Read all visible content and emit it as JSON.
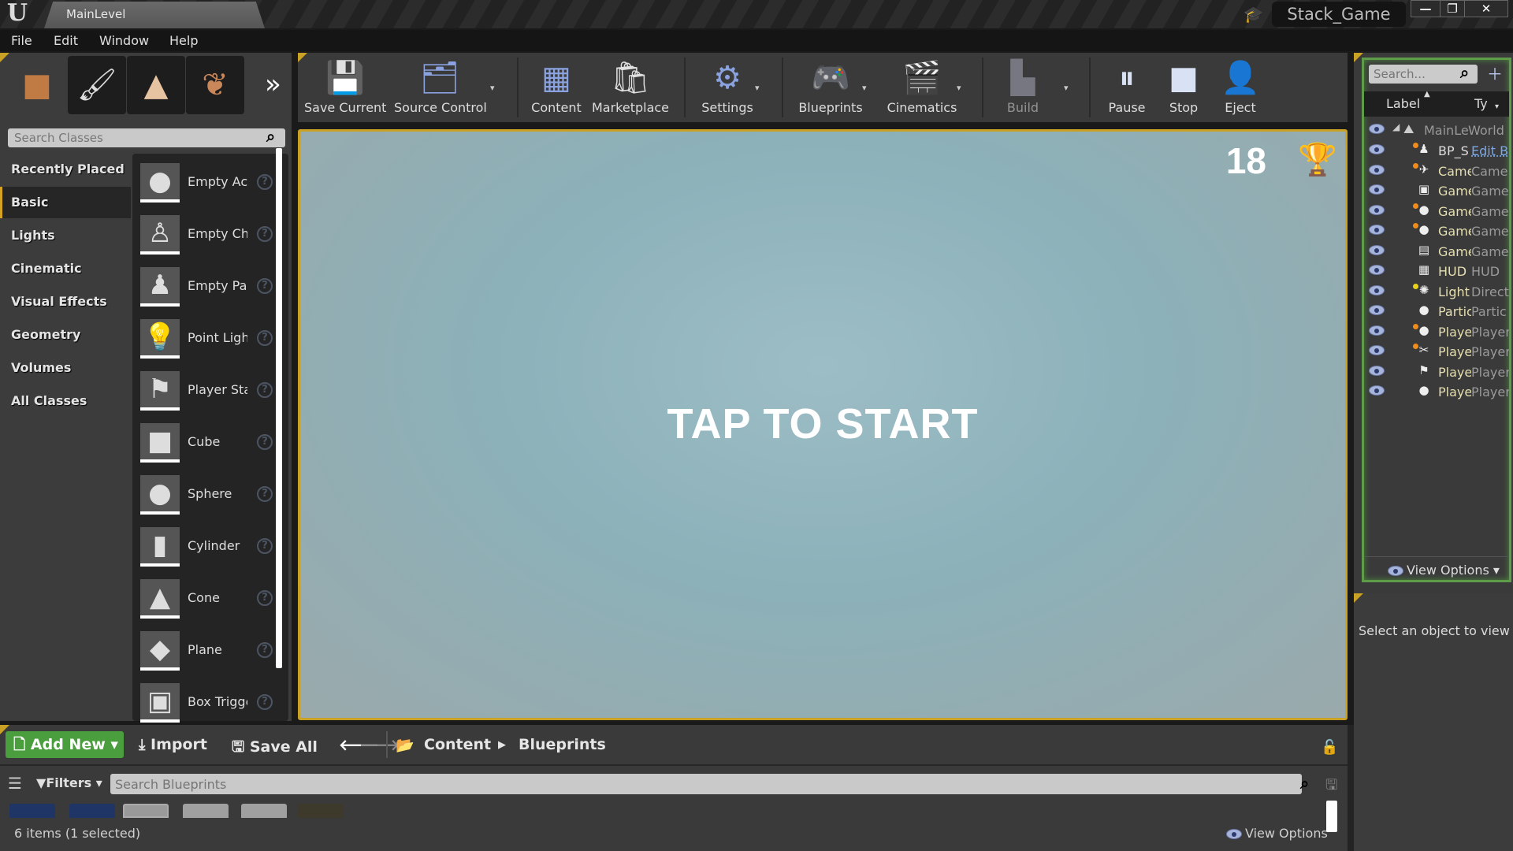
{
  "titlebar": {
    "level_tab": "MainLevel",
    "project_name": "Stack_Game",
    "minimize": "—",
    "restore": "❐",
    "close": "✕"
  },
  "menu": [
    "File",
    "Edit",
    "Window",
    "Help"
  ],
  "modes": [
    {
      "name": "place-mode",
      "glyph": "■"
    },
    {
      "name": "paint-mode",
      "glyph": "🖌"
    },
    {
      "name": "landscape-mode",
      "glyph": "▲"
    },
    {
      "name": "foliage-mode",
      "glyph": "❦"
    }
  ],
  "modes_more": "»",
  "toolbar": {
    "save_current": "Save Current",
    "source_control": "Source Control",
    "content": "Content",
    "marketplace": "Marketplace",
    "settings": "Settings",
    "blueprints": "Blueprints",
    "cinematics": "Cinematics",
    "build": "Build",
    "pause": "Pause",
    "stop": "Stop",
    "eject": "Eject",
    "dropdown": "▾"
  },
  "place_panel": {
    "search_placeholder": "Search Classes",
    "categories": [
      "Recently Placed",
      "Basic",
      "Lights",
      "Cinematic",
      "Visual Effects",
      "Geometry",
      "Volumes",
      "All Classes"
    ],
    "active_category": "Basic",
    "classes": [
      {
        "name": "Empty Actor",
        "thumb": "●"
      },
      {
        "name": "Empty Character",
        "thumb": "♙"
      },
      {
        "name": "Empty Pawn",
        "thumb": "♟"
      },
      {
        "name": "Point Light",
        "thumb": "💡"
      },
      {
        "name": "Player Start",
        "thumb": "⚑"
      },
      {
        "name": "Cube",
        "thumb": "■"
      },
      {
        "name": "Sphere",
        "thumb": "●"
      },
      {
        "name": "Cylinder",
        "thumb": "▮"
      },
      {
        "name": "Cone",
        "thumb": "▲"
      },
      {
        "name": "Plane",
        "thumb": "◆"
      },
      {
        "name": "Box Trigger",
        "thumb": "▣"
      }
    ],
    "help_glyph": "?"
  },
  "viewport": {
    "center_text": "TAP TO START",
    "score": "18",
    "accent": "#c9a225"
  },
  "outliner": {
    "search_placeholder": "Search...",
    "col_label": "Label",
    "col_type": "Ty",
    "world": {
      "label": "MainLe",
      "type": "World"
    },
    "rows": [
      {
        "label": "BP_S",
        "type": "Edit B",
        "icon": "♟",
        "dot": "#f08c1a",
        "link": true
      },
      {
        "label": "Came",
        "type": "Came",
        "icon": "✈",
        "dot": "#f08c1a"
      },
      {
        "label": "Game",
        "type": "Game",
        "icon": "▣",
        "dot": ""
      },
      {
        "label": "Game",
        "type": "Game",
        "icon": "●",
        "dot": "#f08c1a"
      },
      {
        "label": "Game",
        "type": "Game",
        "icon": "●",
        "dot": "#f08c1a"
      },
      {
        "label": "Game",
        "type": "Game",
        "icon": "▤",
        "dot": ""
      },
      {
        "label": "HUD",
        "type": "HUD",
        "icon": "▦",
        "dot": ""
      },
      {
        "label": "Light",
        "type": "Direct",
        "icon": "✺",
        "dot": "#e8d21a"
      },
      {
        "label": "Partic",
        "type": "Partic",
        "icon": "●",
        "dot": ""
      },
      {
        "label": "Playe",
        "type": "Player",
        "icon": "●",
        "dot": "#f08c1a"
      },
      {
        "label": "Playe",
        "type": "Player",
        "icon": "✂",
        "dot": "#f08c1a"
      },
      {
        "label": "Playe",
        "type": "Player",
        "icon": "⚑",
        "dot": ""
      },
      {
        "label": "Playe",
        "type": "Player",
        "icon": "●",
        "dot": ""
      }
    ],
    "view_options": "View Options"
  },
  "details": {
    "empty_text": "Select an object to view details."
  },
  "content_browser": {
    "add_new": "Add New",
    "import": "Import",
    "save_all": "Save All",
    "breadcrumb": [
      "Content",
      "Blueprints"
    ],
    "filters": "Filters",
    "search_placeholder": "Search Blueprints",
    "items_status": "6 items (1 selected)",
    "view_options": "View Options"
  }
}
